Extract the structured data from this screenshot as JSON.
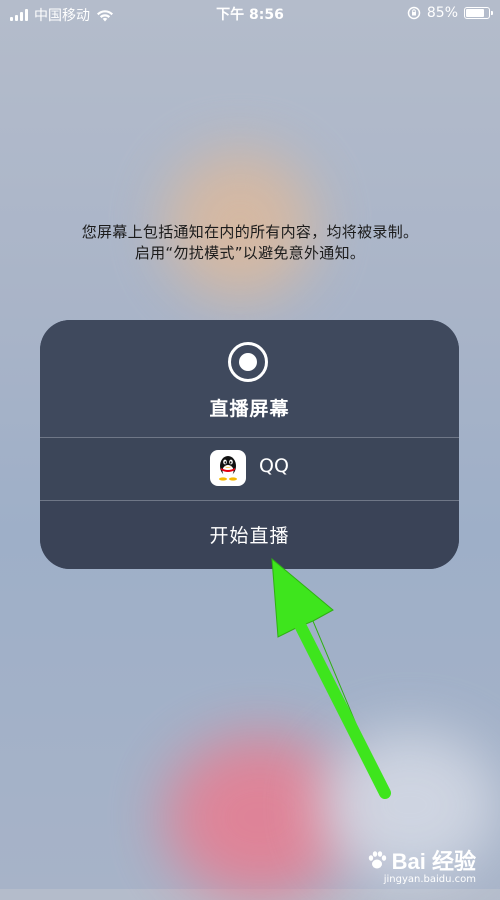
{
  "status_bar": {
    "carrier": "中国移动",
    "time": "下午 8:56",
    "battery_percent": "85%",
    "battery_level": 0.85
  },
  "info": {
    "line1": "您屏幕上包括通知在内的所有内容，均将被录制。",
    "line2": "启用“勿扰模式”以避免意外通知。"
  },
  "broadcast_sheet": {
    "title": "直播屏幕",
    "app_name": "QQ",
    "start_button": "开始直播"
  },
  "watermark": {
    "logo_text": "Bai  经验",
    "url": "jingyan.baidu.com"
  },
  "colors": {
    "sheet_bg": "#3f4a5f",
    "arrow": "#3ee51d"
  }
}
